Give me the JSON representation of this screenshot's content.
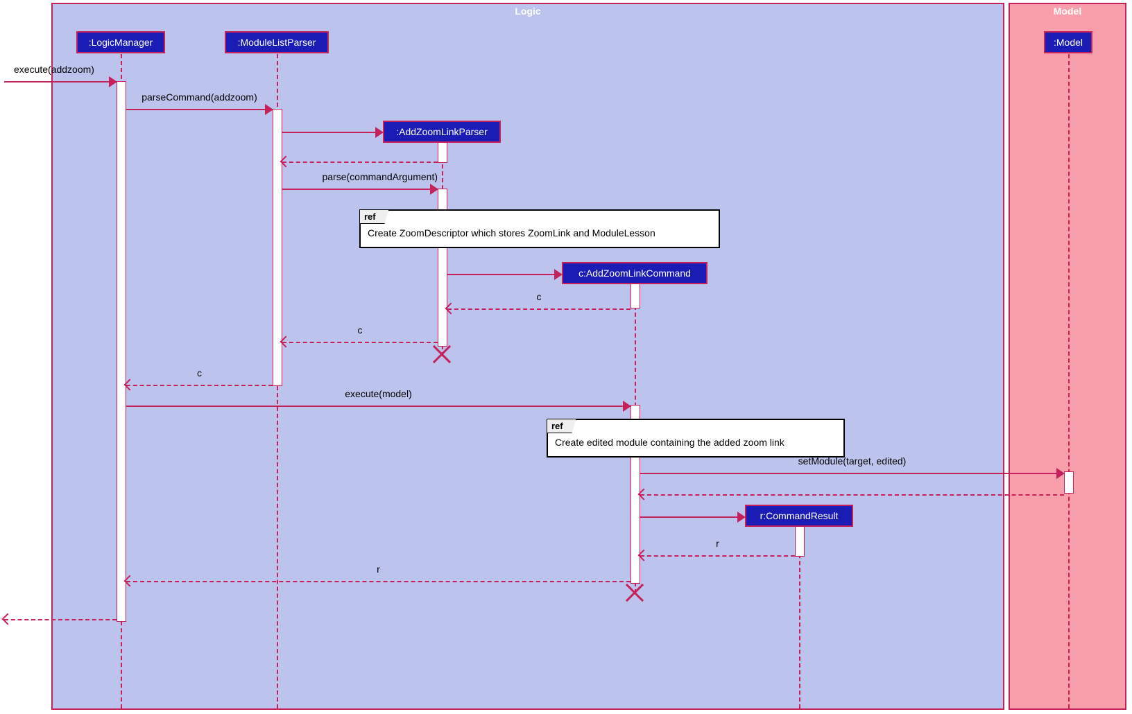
{
  "frames": {
    "logic": "Logic",
    "model": "Model"
  },
  "lifelines": {
    "logicManager": ":LogicManager",
    "moduleListParser": ":ModuleListParser",
    "addZoomLinkParser": ":AddZoomLinkParser",
    "addZoomLinkCommand": "c:AddZoomLinkCommand",
    "commandResult": "r:CommandResult",
    "model": ":Model"
  },
  "messages": {
    "executeAddzoom": "execute(addzoom)",
    "parseCommand": "parseCommand(addzoom)",
    "parseArg": "parse(commandArgument)",
    "c": "c",
    "executeModel": "execute(model)",
    "setModule": "setModule(target, edited)",
    "r": "r"
  },
  "ref": {
    "tag": "ref",
    "createZoomDescriptor": "Create ZoomDescriptor which stores ZoomLink and ModuleLesson",
    "createEditedModule": "Create edited module containing the added zoom link"
  }
}
